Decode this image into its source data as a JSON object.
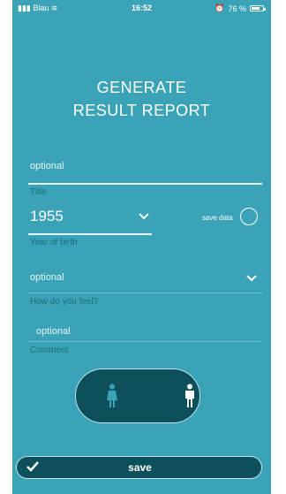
{
  "status": {
    "carrier": "Blau",
    "time": "16:52",
    "battery": "76 %",
    "battery_level": 0.76
  },
  "heading": {
    "line1": "GENERATE",
    "line2": "RESULT REPORT"
  },
  "title_field": {
    "placeholder": "optional",
    "label": "Title"
  },
  "year_field": {
    "value": "1955",
    "label": "Year of birth"
  },
  "save_data": {
    "label": "save data"
  },
  "feel_field": {
    "placeholder": "optional",
    "label": "How do you feel?"
  },
  "comment_field": {
    "placeholder": "optional",
    "label": "Comment"
  },
  "save_button": {
    "label": "save"
  },
  "colors": {
    "background": "#3aa3b7",
    "dark": "#0e4f5c",
    "label": "#1d6e7c"
  }
}
